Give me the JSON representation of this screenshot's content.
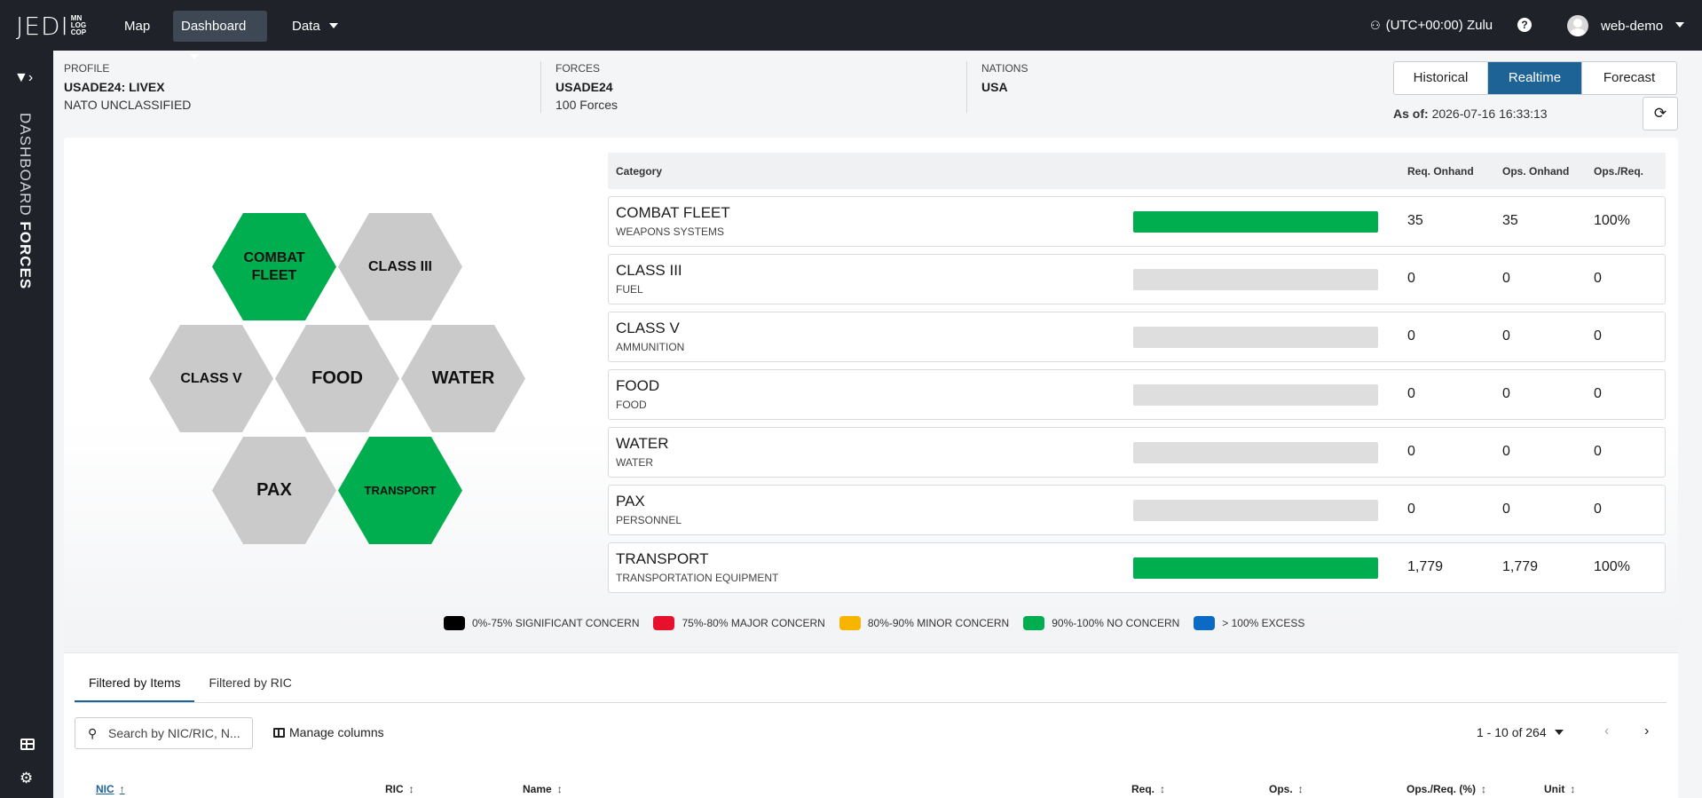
{
  "topbar": {
    "logo_main": "JEDI",
    "logo_sub": [
      "MN",
      "LOG",
      "COP"
    ],
    "nav": [
      {
        "label": "Map"
      },
      {
        "label": "Dashboard"
      },
      {
        "label": "Data"
      }
    ],
    "timezone": "(UTC+00:00) Zulu",
    "help": "?",
    "user": "web-demo"
  },
  "sidebar": {
    "title_light": "DASHBOARD",
    "title_bold": "FORCES"
  },
  "header": {
    "profile": {
      "label": "PROFILE",
      "value": "USADE24: LIVEX",
      "value2": "NATO UNCLASSIFIED"
    },
    "forces": {
      "label": "FORCES",
      "value": "USADE24",
      "value2": "100 Forces"
    },
    "nations": {
      "label": "NATIONS",
      "value": "USA"
    },
    "modes": [
      "Historical",
      "Realtime",
      "Forecast"
    ],
    "selected_mode": "Realtime",
    "as_of_label": "As of:",
    "as_of_value": "2026-07-16 16:33:13"
  },
  "hexes": [
    {
      "label": "COMBAT\nFLEET",
      "status": "green"
    },
    {
      "label": "CLASS III",
      "status": "gray"
    },
    {
      "label": "CLASS V",
      "status": "gray"
    },
    {
      "label": "FOOD",
      "status": "gray"
    },
    {
      "label": "WATER",
      "status": "gray"
    },
    {
      "label": "PAX",
      "status": "gray"
    },
    {
      "label": "TRANSPORT",
      "status": "green"
    }
  ],
  "table": {
    "headers": [
      "Category",
      "Req. Onhand",
      "Ops. Onhand",
      "Ops./Req."
    ],
    "rows": [
      {
        "category": "COMBAT FLEET",
        "sub": "WEAPONS SYSTEMS",
        "fill": 1.0,
        "req": "35",
        "ops": "35",
        "pct": "100%"
      },
      {
        "category": "CLASS III",
        "sub": "FUEL",
        "fill": 0,
        "req": "0",
        "ops": "0",
        "pct": "0"
      },
      {
        "category": "CLASS V",
        "sub": "AMMUNITION",
        "fill": 0,
        "req": "0",
        "ops": "0",
        "pct": "0"
      },
      {
        "category": "FOOD",
        "sub": "FOOD",
        "fill": 0,
        "req": "0",
        "ops": "0",
        "pct": "0"
      },
      {
        "category": "WATER",
        "sub": "WATER",
        "fill": 0,
        "req": "0",
        "ops": "0",
        "pct": "0"
      },
      {
        "category": "PAX",
        "sub": "PERSONNEL",
        "fill": 0,
        "req": "0",
        "ops": "0",
        "pct": "0"
      },
      {
        "category": "TRANSPORT",
        "sub": "TRANSPORTATION EQUIPMENT",
        "fill": 1.0,
        "req": "1,779",
        "ops": "1,779",
        "pct": "100%"
      }
    ]
  },
  "legend": [
    {
      "label": "0%-75% SIGNIFICANT CONCERN",
      "color": "#000000"
    },
    {
      "label": "75%-80% MAJOR CONCERN",
      "color": "#e8112d"
    },
    {
      "label": "80%-90% MINOR CONCERN",
      "color": "#f7b500"
    },
    {
      "label": "90%-100% NO CONCERN",
      "color": "#00ae4f"
    },
    {
      "label": "> 100% EXCESS",
      "color": "#0a6ac4"
    }
  ],
  "bottom": {
    "tabs": [
      "Filtered by Items",
      "Filtered by RIC"
    ],
    "search_placeholder": "Search by NIC/RIC, N...",
    "manage_columns": "Manage columns",
    "pager": "1 - 10 of 264",
    "columns": [
      "NIC",
      "RIC",
      "Name",
      "Req.",
      "Ops.",
      "Ops./Req. (%)",
      "Unit"
    ]
  }
}
